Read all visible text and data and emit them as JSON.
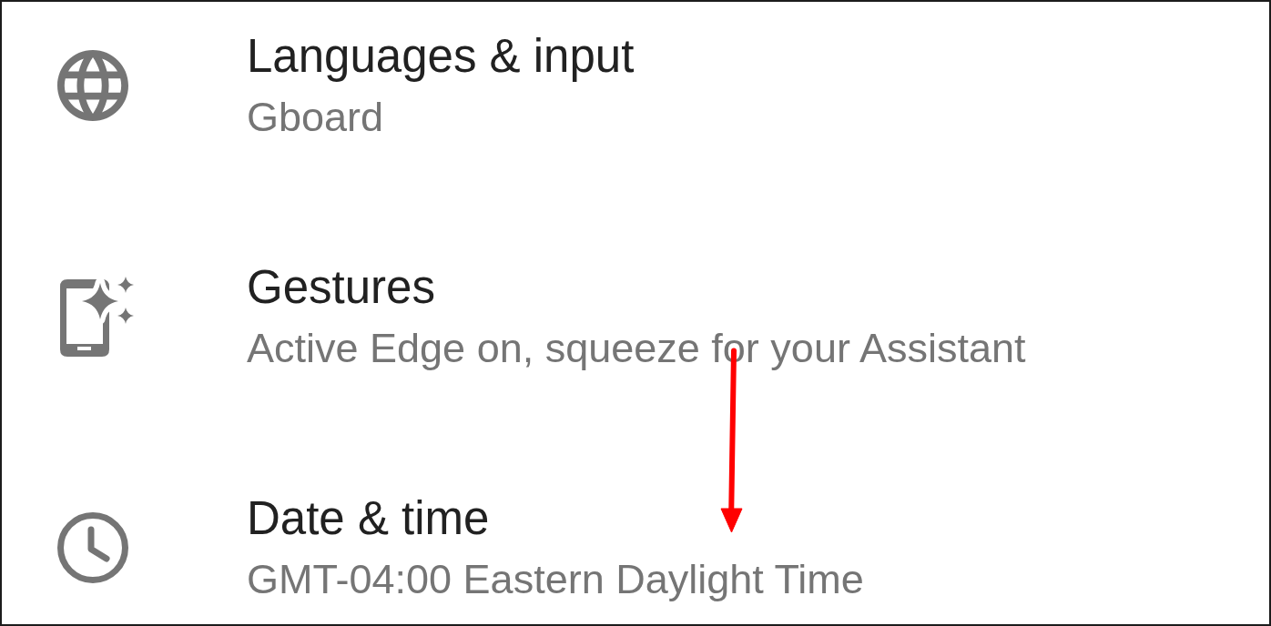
{
  "settings_items": [
    {
      "title": "Languages & input",
      "summary": "Gboard"
    },
    {
      "title": "Gestures",
      "summary": "Active Edge on, squeeze for your Assistant"
    },
    {
      "title": "Date & time",
      "summary": "GMT-04:00 Eastern Daylight Time"
    }
  ],
  "annotations": [
    {
      "kind": "arrow"
    }
  ]
}
